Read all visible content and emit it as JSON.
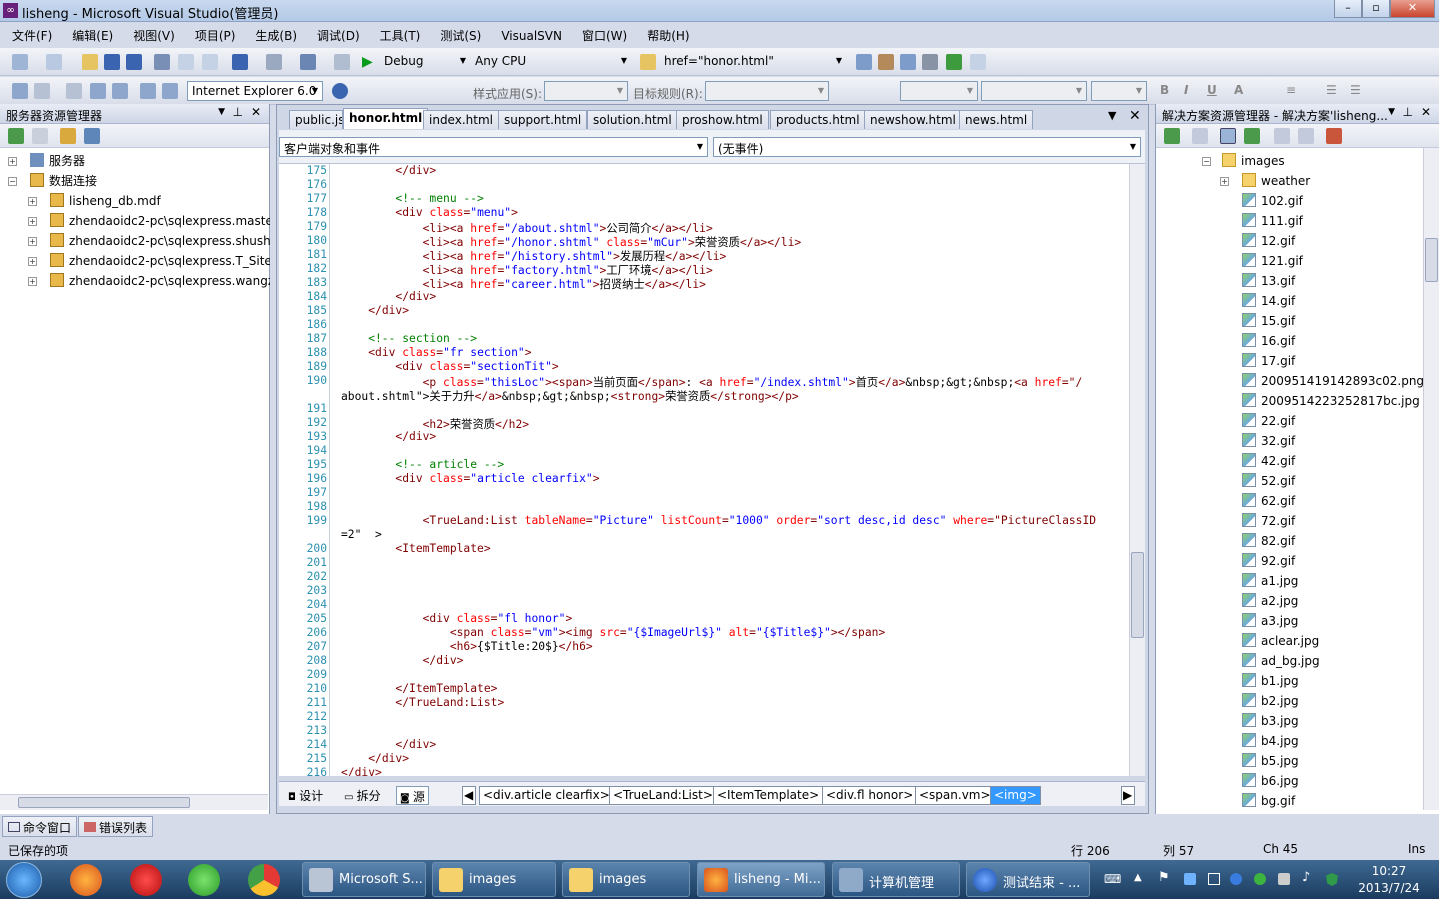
{
  "window": {
    "title": "lisheng - Microsoft Visual Studio(管理员)",
    "buttons": [
      "–",
      "▫",
      "✕"
    ]
  },
  "menu": [
    "文件(F)",
    "编辑(E)",
    "视图(V)",
    "项目(P)",
    "生成(B)",
    "调试(D)",
    "工具(T)",
    "测试(S)",
    "VisualSVN",
    "窗口(W)",
    "帮助(H)"
  ],
  "toolbar1": {
    "config": "Debug",
    "platform": "Any CPU",
    "find": "href=\"honor.html\""
  },
  "toolbar2": {
    "browser": "Internet Explorer 6.0",
    "style_label": "样式应用(S):",
    "target_label": "目标规则(R):"
  },
  "server_explorer": {
    "title": "服务器资源管理器",
    "items": [
      {
        "label": "服务器",
        "type": "server"
      },
      {
        "label": "数据连接",
        "type": "db"
      },
      {
        "label": "lisheng_db.mdf",
        "type": "conn"
      },
      {
        "label": "zhendaoidc2-pc\\sqlexpress.maste",
        "type": "conn"
      },
      {
        "label": "zhendaoidc2-pc\\sqlexpress.shusha",
        "type": "conn"
      },
      {
        "label": "zhendaoidc2-pc\\sqlexpress.T_SiteI",
        "type": "conn"
      },
      {
        "label": "zhendaoidc2-pc\\sqlexpress.wangz",
        "type": "conn"
      }
    ]
  },
  "bottom_tabs": [
    "命令窗口",
    "错误列表"
  ],
  "editor": {
    "tabs": [
      "public.js",
      "honor.html",
      "index.html",
      "support.html",
      "solution.html",
      "proshow.html",
      "products.html",
      "newshow.html",
      "news.html"
    ],
    "active_tab": "honor.html",
    "object_combo": "客户端对象和事件",
    "event_combo": "(无事件)",
    "lines": [
      {
        "n": "175",
        "t": "        </div>"
      },
      {
        "n": "176",
        "t": ""
      },
      {
        "n": "177",
        "t": "        <!-- menu -->"
      },
      {
        "n": "178",
        "t": "        <div class=\"menu\">"
      },
      {
        "n": "179",
        "t": "            <li><a href=\"/about.shtml\">公司简介</a></li>"
      },
      {
        "n": "180",
        "t": "            <li><a href=\"/honor.shtml\" class=\"mCur\">荣誉资质</a></li>"
      },
      {
        "n": "181",
        "t": "            <li><a href=\"/history.shtml\">发展历程</a></li>"
      },
      {
        "n": "182",
        "t": "            <li><a href=\"factory.html\">工厂环境</a></li>"
      },
      {
        "n": "183",
        "t": "            <li><a href=\"career.html\">招贤纳士</a></li>"
      },
      {
        "n": "184",
        "t": "        </div>"
      },
      {
        "n": "185",
        "t": "    </div>"
      },
      {
        "n": "186",
        "t": ""
      },
      {
        "n": "187",
        "t": "    <!-- section -->"
      },
      {
        "n": "188",
        "t": "    <div class=\"fr section\">"
      },
      {
        "n": "189",
        "t": "        <div class=\"sectionTit\">"
      },
      {
        "n": "190",
        "t": "            <p class=\"thisLoc\"><span>当前页面</span>: <a href=\"/index.shtml\">首页</a>&nbsp;&gt;&nbsp;<a href=\"/"
      },
      {
        "n": "",
        "t": "about.shtml\">关于力升</a>&nbsp;&gt;&nbsp;<strong>荣誉资质</strong></p>"
      },
      {
        "n": "191",
        "t": ""
      },
      {
        "n": "192",
        "t": "            <h2>荣誉资质</h2>"
      },
      {
        "n": "193",
        "t": "        </div>"
      },
      {
        "n": "194",
        "t": ""
      },
      {
        "n": "195",
        "t": "        <!-- article -->"
      },
      {
        "n": "196",
        "t": "        <div class=\"article clearfix\">"
      },
      {
        "n": "197",
        "t": ""
      },
      {
        "n": "198",
        "t": ""
      },
      {
        "n": "199",
        "t": "            <TrueLand:List tableName=\"Picture\" listCount=\"1000\" order=\"sort desc,id desc\" where=\"PictureClassID"
      },
      {
        "n": "",
        "t": "=2\"  >"
      },
      {
        "n": "200",
        "t": "        <ItemTemplate>"
      },
      {
        "n": "201",
        "t": ""
      },
      {
        "n": "202",
        "t": ""
      },
      {
        "n": "203",
        "t": ""
      },
      {
        "n": "204",
        "t": ""
      },
      {
        "n": "205",
        "t": "            <div class=\"fl honor\">"
      },
      {
        "n": "206",
        "t": "                <span class=\"vm\"><img src=\"{$ImageUrl$}\" alt=\"{$Title$}\"></span>"
      },
      {
        "n": "207",
        "t": "                <h6>{$Title:20$}</h6>"
      },
      {
        "n": "208",
        "t": "            </div>"
      },
      {
        "n": "209",
        "t": ""
      },
      {
        "n": "210",
        "t": "        </ItemTemplate>"
      },
      {
        "n": "211",
        "t": "        </TrueLand:List>"
      },
      {
        "n": "212",
        "t": ""
      },
      {
        "n": "213",
        "t": ""
      },
      {
        "n": "214",
        "t": "        </div>"
      },
      {
        "n": "215",
        "t": "    </div>"
      },
      {
        "n": "216",
        "t": "</div>"
      }
    ],
    "view_tabs": [
      "设计",
      "拆分",
      "源"
    ],
    "breadcrumbs": [
      "<div.article clearfix>",
      "<TrueLand:List>",
      "<ItemTemplate>",
      "<div.fl honor>",
      "<span.vm>",
      "<img>"
    ]
  },
  "solution_explorer": {
    "title": "解决方案资源管理器 - 解决方案'lisheng...",
    "folder": "images",
    "subfolder": "weather",
    "files": [
      "102.gif",
      "111.gif",
      "12.gif",
      "121.gif",
      "13.gif",
      "14.gif",
      "15.gif",
      "16.gif",
      "17.gif",
      "200951419142893c02.png",
      "2009514223252817bc.jpg",
      "22.gif",
      "32.gif",
      "42.gif",
      "52.gif",
      "62.gif",
      "72.gif",
      "82.gif",
      "92.gif",
      "a1.jpg",
      "a2.jpg",
      "a3.jpg",
      "aclear.jpg",
      "ad_bg.jpg",
      "b1.jpg",
      "b2.jpg",
      "b3.jpg",
      "b4.jpg",
      "b5.jpg",
      "b6.jpg",
      "bg.gif"
    ]
  },
  "status": {
    "left": "已保存的项",
    "row": "行 206",
    "col": "列 57",
    "ch": "Ch 45",
    "mode": "Ins"
  },
  "taskbar": {
    "tasks": [
      "Microsoft S...",
      "images",
      "images",
      "lisheng - Mi...",
      "计算机管理",
      "测试结束 - ..."
    ],
    "time": "10:27",
    "date": "2013/7/24"
  }
}
